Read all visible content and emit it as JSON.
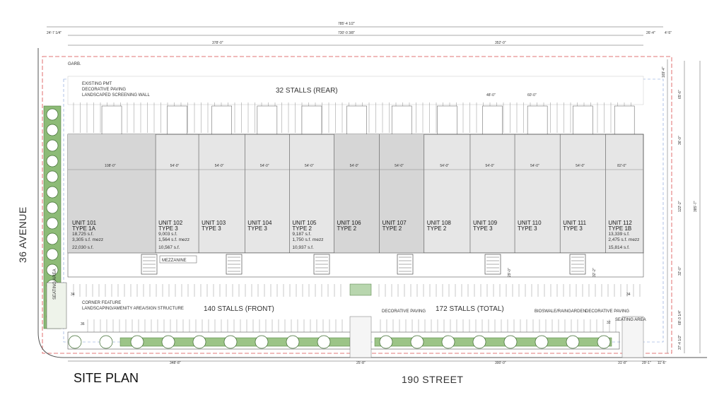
{
  "title": "SITE PLAN",
  "streets": {
    "south": "190 STREET",
    "west": "36 AVENUE"
  },
  "stalls": {
    "rear": "32 STALLS (REAR)",
    "front": "140 STALLS (FRONT)",
    "total": "172 STALLS (TOTAL)"
  },
  "callouts": {
    "garb": "GARB.",
    "existing_pmt": "EXISTING PMT",
    "decorative_paving_nw": "DECORATIVE PAVING",
    "landscaped_wall": "LANDSCAPED SCREENING WALL",
    "corner_feature_1": "CORNER FEATURE",
    "corner_feature_2": "LANDSCAPING/AMENITY AREA/SIGN STRUCTURE",
    "decorative_paving_mid": "DECORATIVE PAVING",
    "bioswale": "BIOSWALE/RAINGARDEN",
    "decorative_paving_east": "DECORATIVE PAVING",
    "seating_area_east": "SEATING AREA",
    "seating_area_west": "SEATING AREA",
    "mezzanine": "MEZZANINE"
  },
  "dimensions": {
    "overall": "785'-4 1/2\"",
    "building": "730'-0 3/8\"",
    "left_setback": "24'-7 1/4\"",
    "right_setback_a": "26'-4\"",
    "right_setback_b": "4'-5\"",
    "west_half": "378'-0\"",
    "east_half": "352'-0\"",
    "loading_a": "48'-0\"",
    "loading_b": "60'-0\"",
    "bottom_west": "348'-8\"",
    "bottom_driveway": "25'-8\"",
    "bottom_east": "300'-0\"",
    "bottom_r1": "31'-8\"",
    "bottom_r2": "29'-1\"",
    "bottom_r3": "11'-6\"",
    "stall_count_a": "34",
    "stall_count_b": "36",
    "stall_count_c": "34",
    "stall_count_d": "32",
    "right_vertical_1": "65'-6\"",
    "right_vertical_2": "36'-0\"",
    "right_vertical_3": "122'-2\"",
    "right_vertical_4": "385'-7\"",
    "right_vertical_5": "169'-4\"",
    "right_vertical_6": "32'-0\"",
    "right_vertical_7": "68'-3 1/4\"",
    "right_vertical_8": "37'-4 1/2\"",
    "mezz_dim_a": "29'-0\"",
    "mezz_dim_b": "32'-2\""
  },
  "bay_widths": [
    "108'-0\"",
    "54'-0\"",
    "54'-0\"",
    "54'-0\"",
    "54'-0\"",
    "54'-0\"",
    "54'-0\"",
    "54'-0\"",
    "54'-0\"",
    "54'-0\"",
    "54'-0\"",
    "82'-0\""
  ],
  "units": [
    {
      "name": "UNIT 101",
      "type": "TYPE 1A",
      "sf": "18,725 s.f.",
      "mezz": "3,305 s.f. mezz",
      "total": "22,030 s.f."
    },
    {
      "name": "UNIT 102",
      "type": "TYPE 3",
      "sf": "9,003 s.f.",
      "mezz": "1,564 s.f. mezz",
      "total": "10,567 s.f."
    },
    {
      "name": "UNIT 103",
      "type": "TYPE 3",
      "sf": "",
      "mezz": "",
      "total": ""
    },
    {
      "name": "UNIT 104",
      "type": "TYPE 3",
      "sf": "",
      "mezz": "",
      "total": ""
    },
    {
      "name": "UNIT 105",
      "type": "TYPE 2",
      "sf": "9,187 s.f.",
      "mezz": "1,750 s.f. mezz",
      "total": "10,937 s.f."
    },
    {
      "name": "UNIT 106",
      "type": "TYPE 2",
      "sf": "",
      "mezz": "",
      "total": ""
    },
    {
      "name": "UNIT 107",
      "type": "TYPE 2",
      "sf": "",
      "mezz": "",
      "total": ""
    },
    {
      "name": "UNIT 108",
      "type": "TYPE 2",
      "sf": "",
      "mezz": "",
      "total": ""
    },
    {
      "name": "UNIT 109",
      "type": "TYPE 3",
      "sf": "",
      "mezz": "",
      "total": ""
    },
    {
      "name": "UNIT 110",
      "type": "TYPE 3",
      "sf": "",
      "mezz": "",
      "total": ""
    },
    {
      "name": "UNIT 111",
      "type": "TYPE 3",
      "sf": "",
      "mezz": "",
      "total": ""
    },
    {
      "name": "UNIT 112",
      "type": "TYPE 1B",
      "sf": "13,339 s.f.",
      "mezz": "2,475 s.f. mezz",
      "total": "15,814 s.f."
    }
  ],
  "colors": {
    "building_fill": "#e6e6e6",
    "unit_shade": "#d6d6d6",
    "grass": "#7fae6a",
    "property_line": "#d94b4b",
    "setback_line": "#7a9ad8",
    "ink": "#333333"
  }
}
